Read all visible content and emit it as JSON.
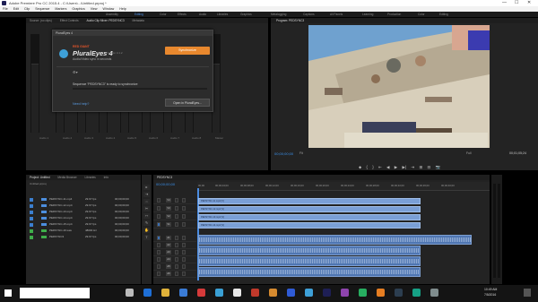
{
  "window": {
    "title": "Adobe Premiere Pro CC 2015.4 - C:\\Users\\...\\Untitled.prproj *",
    "controls": [
      "—",
      "☐",
      "✕"
    ]
  },
  "menu": [
    "File",
    "Edit",
    "Clip",
    "Sequence",
    "Markers",
    "Graphics",
    "View",
    "Window",
    "Help"
  ],
  "workspaces": [
    {
      "label": "Assembly",
      "active": false
    },
    {
      "label": "Editing",
      "active": true
    },
    {
      "label": "Color",
      "active": false
    },
    {
      "label": "Effects",
      "active": false
    },
    {
      "label": "Audio",
      "active": false
    },
    {
      "label": "Libraries",
      "active": false
    },
    {
      "label": "Graphics",
      "active": false
    },
    {
      "label": "Metalogging",
      "active": false
    },
    {
      "label": "Captions",
      "active": false
    },
    {
      "label": "All Panels",
      "active": false
    },
    {
      "label": "Learning",
      "active": false
    },
    {
      "label": "Production",
      "active": false
    },
    {
      "label": "Color",
      "active": false
    },
    {
      "label": "Editing",
      "active": false
    }
  ],
  "source_tabs": [
    "Source: (no clips)",
    "Effect Controls",
    "Audio Clip Mixer: PEDSYNC3",
    "Metadata"
  ],
  "mixer": {
    "channels": [
      "Audio 1",
      "Audio 2",
      "Audio 3",
      "Audio 4",
      "Audio 5",
      "Audio 6",
      "Audio 7",
      "Audio 8",
      "Master"
    ]
  },
  "pluraleyes": {
    "window_title": "PluralEyes 4",
    "brand": "RED GIANT",
    "name": "PluralEyes 4",
    "version": "Version 4.1.2",
    "subtitle": "Audio/Video sync in seconds",
    "sync_button": "Synchronize",
    "message": "Sequence \"PEDSYNC3\" is ready to synchronize",
    "help_link": "Need help?",
    "open_button": "Open in PluralEyes..."
  },
  "program": {
    "tab": "Program: PEDSYNC3",
    "timecode": "00;00;00;00",
    "fit": "Fit",
    "quality": "Full",
    "duration": "00;01;05;24",
    "transport": [
      "⬥",
      "{",
      "}",
      "⇤",
      "◀",
      "▶",
      "▶|",
      "⇥",
      "⊞",
      "⊟",
      "📷"
    ]
  },
  "project": {
    "tabs": [
      "Project: Untitled",
      "Media Browser",
      "Libraries",
      "Info"
    ],
    "path": "Untitled.prproj",
    "items": [
      {
        "name": "PEDSYNC-11.mp4",
        "rate": "29.97 fps",
        "start": "00;00;00;00",
        "color": "#3b7fd0"
      },
      {
        "name": "PEDSYNC-12.mp4",
        "rate": "29.97 fps",
        "start": "00;00;00;00",
        "color": "#3b7fd0"
      },
      {
        "name": "PEDSYNC-13.mp4",
        "rate": "29.97 fps",
        "start": "00;00;00;00",
        "color": "#3b7fd0"
      },
      {
        "name": "PEDSYNC-14.mp4",
        "rate": "29.97 fps",
        "start": "00;00;00;00",
        "color": "#3b7fd0"
      },
      {
        "name": "PEDSYNC-15.mp4",
        "rate": "29.97 fps",
        "start": "00;00;00;00",
        "color": "#3b7fd0"
      },
      {
        "name": "PEDSYNC-16.wav",
        "rate": "48000 Hz",
        "start": "00;00;00;00",
        "color": "#3fae4a"
      },
      {
        "name": "PEDSYNC3",
        "rate": "29.97 fps",
        "start": "00;00;00;00",
        "color": "#3fae4a"
      }
    ]
  },
  "timeline": {
    "tab": "PEDSYNC3",
    "timecode": "00;00;00;00",
    "ruler": [
      "00;00",
      "00;00;04;00",
      "00;00;08;00",
      "00;00;12;00",
      "00;00;16;00",
      "00;00;20;00",
      "00;00;24;00",
      "00;00;28;00",
      "00;00;32;00",
      "00;00;36;00",
      "00;00;40;00"
    ],
    "video_tracks": [
      "V4",
      "V3",
      "V2",
      "V1"
    ],
    "audio_tracks": [
      "A1",
      "A2",
      "A3",
      "A4",
      "A5",
      "A6",
      "A7",
      "A8"
    ],
    "video_clips": [
      "PEDSYNC-11.mp4 [V]",
      "PEDSYNC-12.mp4 [V]",
      "PEDSYNC-13.mp4 [V]",
      "PEDSYNC-14.mp4 [V]"
    ]
  },
  "tools": [
    "▸",
    "⇥",
    "⇔",
    "✂",
    "⇿",
    "✎",
    "✋",
    "T"
  ],
  "taskbar": {
    "time": "10:49 AM",
    "date": "7/5/2016"
  }
}
